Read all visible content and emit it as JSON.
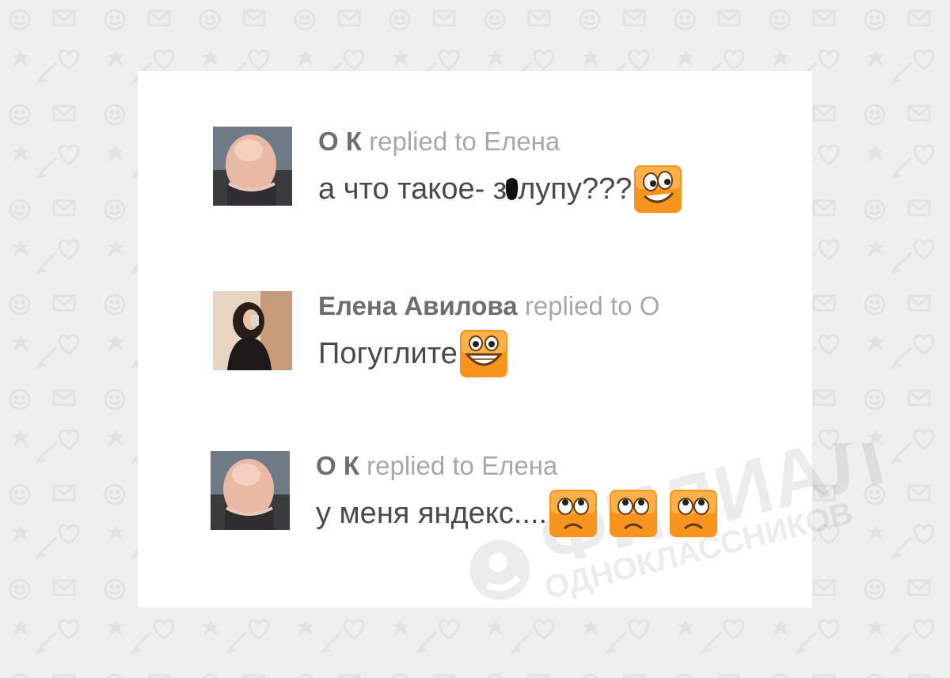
{
  "comments": [
    {
      "author": "О К",
      "replied": "replied to Елена",
      "text_before": "а что такое- з",
      "text_after": "лупу???",
      "smiles": [
        "grin-smile-icon"
      ]
    },
    {
      "author": "Елена Авилова",
      "replied": "replied to О",
      "text_before": "Погуглите",
      "text_after": "",
      "smiles": [
        "laugh-smile-icon"
      ]
    },
    {
      "author": "О К",
      "replied": "replied to Елена",
      "text_before": "у меня яндекс....",
      "text_after": "",
      "smiles": [
        "sad-smile-icon",
        "sad-smile-icon",
        "sad-smile-icon"
      ]
    }
  ],
  "watermark": {
    "title": "ФИЛИАЛ",
    "subtitle": "ОДНОКЛАССНИКОВ"
  },
  "colors": {
    "background": "#efefef",
    "card": "#ffffff",
    "author": "#6e6e6e",
    "meta": "#a8a8a8",
    "text": "#4a4a4a",
    "smile_orange": "#f7941d"
  }
}
